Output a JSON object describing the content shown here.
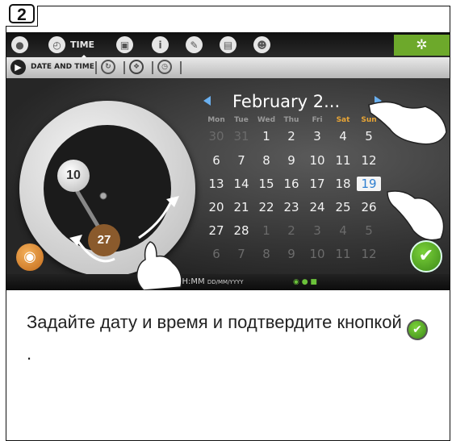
{
  "step": "2",
  "topbar": {
    "time_tab_label": "TIME",
    "icons": [
      "water-drop-icon",
      "clock-icon",
      "cup-icon",
      "info-icon",
      "brush-icon",
      "calculator-icon",
      "profile-icon"
    ],
    "settings_color": "#6da92b"
  },
  "subbar": {
    "date_time_label": "DATE AND TIME"
  },
  "dial": {
    "hour": "10",
    "minute": "27"
  },
  "calendar": {
    "month_label": "February 2...",
    "weekdays": [
      "Mon",
      "Tue",
      "Wed",
      "Thu",
      "Fri",
      "Sat",
      "Sun"
    ],
    "weeks": [
      [
        "30",
        "31",
        "1",
        "2",
        "3",
        "4",
        "5"
      ],
      [
        "6",
        "7",
        "8",
        "9",
        "10",
        "11",
        "12"
      ],
      [
        "13",
        "14",
        "15",
        "16",
        "17",
        "18",
        "19"
      ],
      [
        "20",
        "21",
        "22",
        "23",
        "24",
        "25",
        "26"
      ],
      [
        "27",
        "28",
        "1",
        "2",
        "3",
        "4",
        "5"
      ],
      [
        "6",
        "7",
        "8",
        "9",
        "10",
        "11",
        "12"
      ]
    ],
    "selected_day": "19",
    "weekend_color": "#e8a536"
  },
  "status": {
    "format_main": "HH:MM",
    "format_date": "DD/MM/YYYY"
  },
  "caption": {
    "text": "Задайте дату и время и подтвердите кнопкой",
    "suffix": "."
  }
}
